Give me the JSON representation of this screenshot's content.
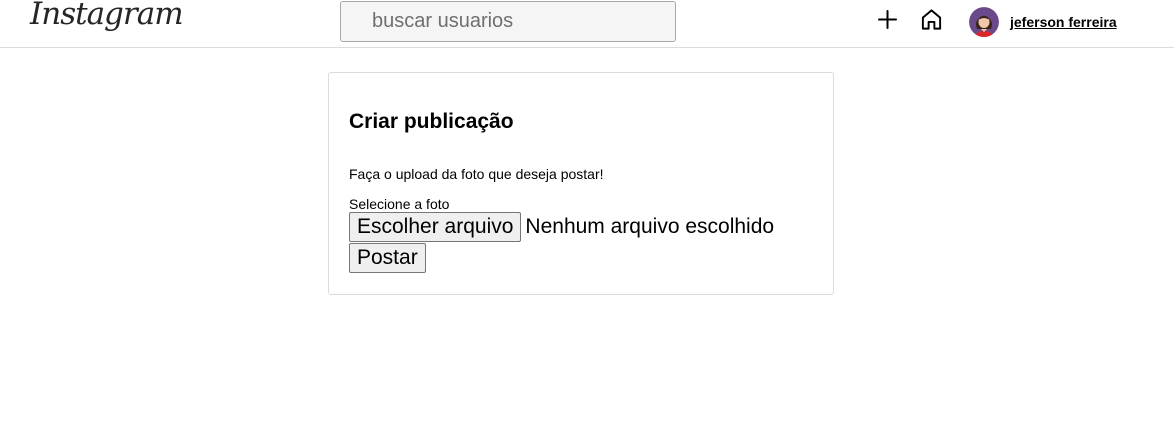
{
  "header": {
    "logo_text": "Instagram",
    "search": {
      "placeholder": "buscar usuarios",
      "value": ""
    },
    "icons": [
      "plus-icon",
      "home-icon"
    ],
    "username": "jeferson ferreira"
  },
  "post_form": {
    "title": "Criar publicação",
    "description": "Faça o upload da foto que deseja postar!",
    "file_label": "Selecione a foto",
    "choose_file_label": "Escolher arquivo",
    "file_status": "Nenhum arquivo escolhido",
    "submit_label": "Postar"
  },
  "colors": {
    "border": "#dbdbdb",
    "search_bg": "#f5f5f5",
    "button_bg": "#efefef",
    "avatar_bg": "#6b4a8c"
  }
}
